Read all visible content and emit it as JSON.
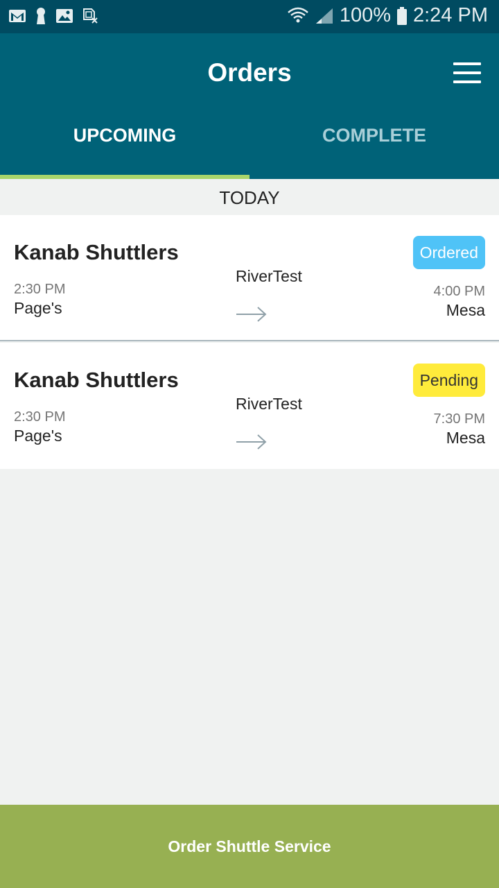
{
  "status_bar": {
    "left_icons": [
      "gmail-icon",
      "keyhole-icon",
      "image-icon",
      "sim-card-icon"
    ],
    "battery_percent": "100%",
    "time": "2:24 PM"
  },
  "header": {
    "title": "Orders",
    "menu_icon": "hamburger-menu-icon"
  },
  "tabs": [
    {
      "label": "UPCOMING",
      "active": true
    },
    {
      "label": "COMPLETE",
      "active": false
    }
  ],
  "section": {
    "label": "TODAY"
  },
  "orders": [
    {
      "company": "Kanab Shuttlers",
      "trip": "RiverTest",
      "from_time": "2:30 PM",
      "from_place": "Page's",
      "to_time": "4:00 PM",
      "to_place": "Mesa",
      "status": "Ordered",
      "status_color": "#4fc3f7"
    },
    {
      "company": "Kanab Shuttlers",
      "trip": "RiverTest",
      "from_time": "2:30 PM",
      "from_place": "Page's",
      "to_time": "7:30 PM",
      "to_place": "Mesa",
      "status": "Pending",
      "status_color": "#ffeb3b"
    }
  ],
  "footer": {
    "button_label": "Order Shuttle Service"
  },
  "colors": {
    "status_bar": "#004b61",
    "app_bar": "#006278",
    "tab_indicator": "#a8d56b",
    "footer_button": "#97b052"
  }
}
